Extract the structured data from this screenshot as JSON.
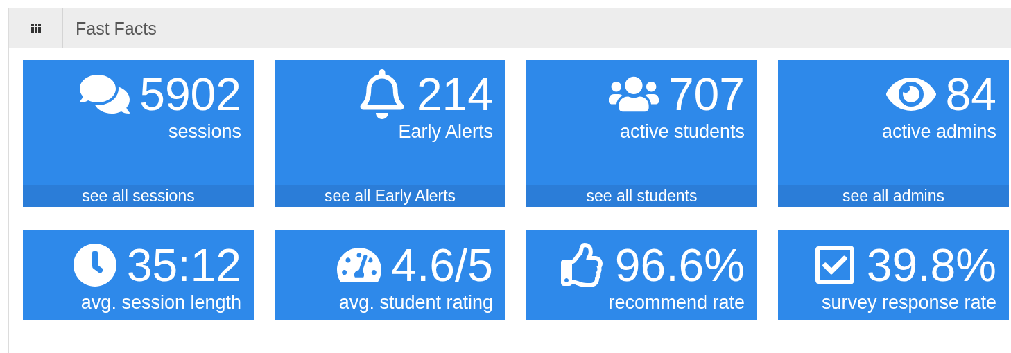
{
  "header": {
    "title": "Fast Facts"
  },
  "tile_rows": [
    {
      "tiles": [
        {
          "value": "5902",
          "label": "sessions",
          "link": "see all sessions"
        },
        {
          "value": "214",
          "label": "Early Alerts",
          "link": "see all Early Alerts"
        },
        {
          "value": "707",
          "label": "active students",
          "link": "see all students"
        },
        {
          "value": "84",
          "label": "active admins",
          "link": "see all admins"
        }
      ]
    },
    {
      "tiles": [
        {
          "value": "35:12",
          "label": "avg. session length"
        },
        {
          "value": "4.6/5",
          "label": "avg. student rating"
        },
        {
          "value": "96.6%",
          "label": "recommend rate"
        },
        {
          "value": "39.8%",
          "label": "survey response rate"
        }
      ]
    }
  ]
}
